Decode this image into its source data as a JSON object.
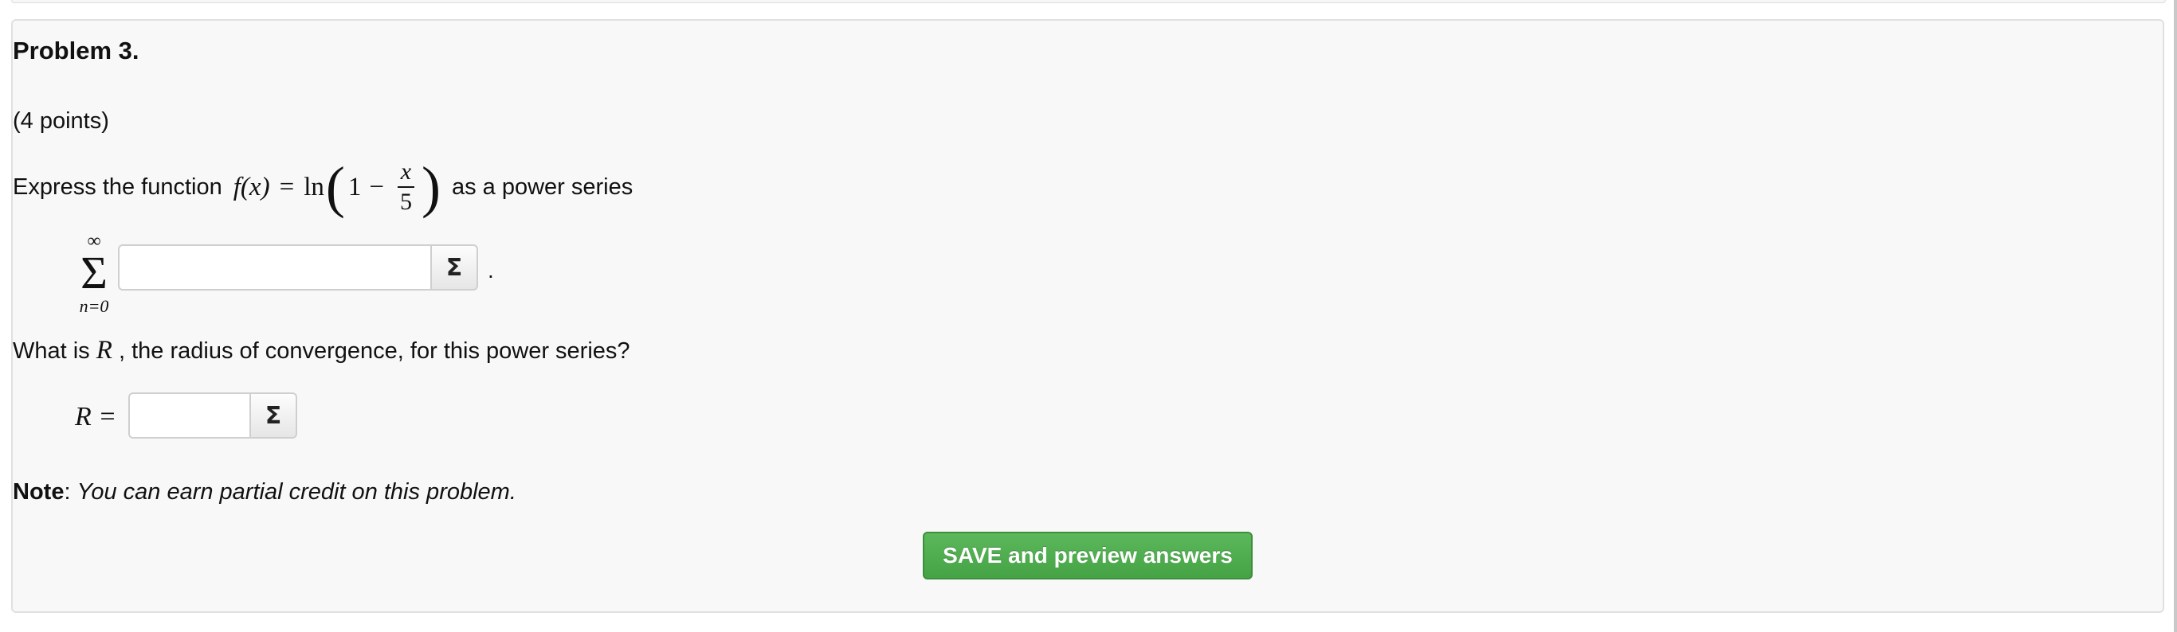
{
  "problem": {
    "title": "Problem 3.",
    "points": "(4 points)",
    "statement_prefix": "Express the function",
    "statement_suffix": "as a power series",
    "function": {
      "lhs": "f(x)",
      "equals": "=",
      "ln": "ln",
      "open_paren": "(",
      "one": "1",
      "minus": "−",
      "frac_num": "x",
      "frac_den": "5",
      "close_paren": ")"
    },
    "sum": {
      "upper": "∞",
      "symbol": "Σ",
      "lower": "n=0"
    },
    "series_input": {
      "value": "",
      "placeholder": ""
    },
    "equation_button_label": "Σ",
    "period": ".",
    "question_prefix": "What is",
    "question_var": "R",
    "question_suffix": ", the radius of convergence, for this power series?",
    "radius_label": "R =",
    "radius_input": {
      "value": "",
      "placeholder": ""
    },
    "note_label": "Note",
    "note_colon": ":",
    "note_text": "You can earn partial credit on this problem."
  },
  "actions": {
    "save_label": "SAVE and preview answers"
  },
  "colors": {
    "panel_bg": "#f8f8f8",
    "panel_border": "#e0e0e0",
    "save_button": "#4cae4c",
    "text": "#111111"
  }
}
